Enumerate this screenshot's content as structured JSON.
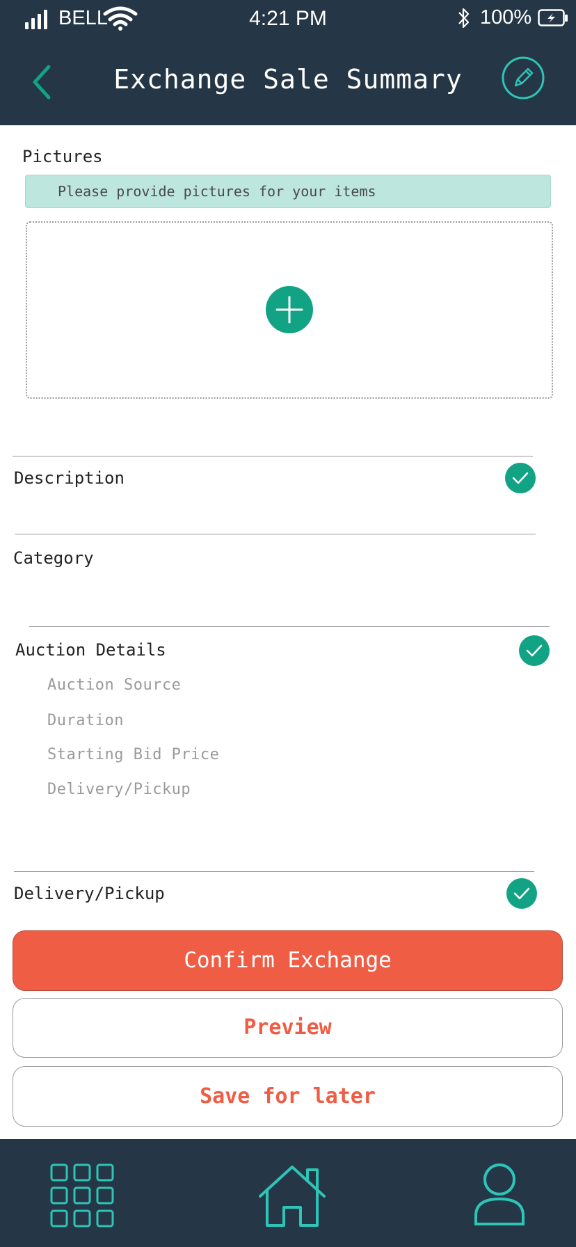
{
  "status_bar": {
    "carrier": "BELL",
    "time": "4:21 PM",
    "battery": "100%"
  },
  "header": {
    "title": "Exchange Sale Summary",
    "back_icon": "chevron-left-icon",
    "edit_icon": "pencil-icon"
  },
  "pictures": {
    "label": "Pictures",
    "hint": "Please provide pictures for your items",
    "add_icon": "plus-icon"
  },
  "sections": {
    "description": {
      "label": "Description",
      "complete": true
    },
    "category": {
      "label": "Category",
      "complete": false
    },
    "auction_details": {
      "label": "Auction Details",
      "complete": true,
      "items": [
        "Auction Source",
        "Duration",
        "Starting Bid Price",
        "Delivery/Pickup"
      ]
    },
    "delivery_pickup": {
      "label": "Delivery/Pickup",
      "complete": true
    }
  },
  "actions": {
    "confirm": "Confirm Exchange",
    "preview": "Preview",
    "save": "Save for later"
  },
  "bottom_nav": [
    "grid-icon",
    "home-icon",
    "profile-icon"
  ],
  "colors": {
    "header_bg": "#253746",
    "accent_teal": "#11a384",
    "hint_bg": "#bce6de",
    "primary_button": "#f05d45",
    "nav_icon": "#2ec4b6"
  }
}
